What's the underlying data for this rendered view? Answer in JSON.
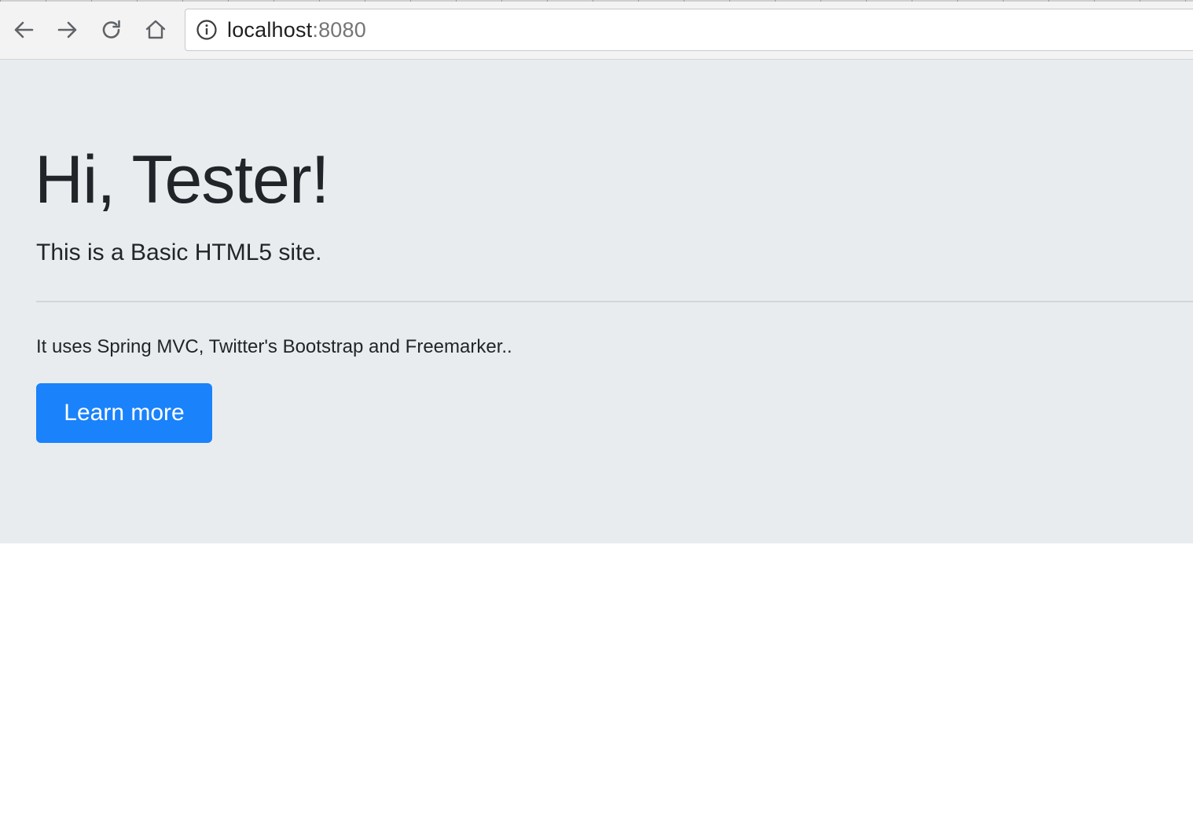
{
  "browser": {
    "url_host": "localhost",
    "url_port": ":8080",
    "nav_icons": [
      "arrow-left-icon",
      "arrow-right-icon",
      "reload-icon",
      "home-icon",
      "info-icon"
    ]
  },
  "jumbotron": {
    "title": "Hi, Tester!",
    "lead": "This is a Basic HTML5 site.",
    "description": "It uses Spring MVC, Twitter's Bootstrap and Freemarker..",
    "button_label": "Learn more"
  },
  "colors": {
    "jumbotron_bg": "#e9ecef",
    "primary": "#1a82fb",
    "text": "#212529"
  }
}
